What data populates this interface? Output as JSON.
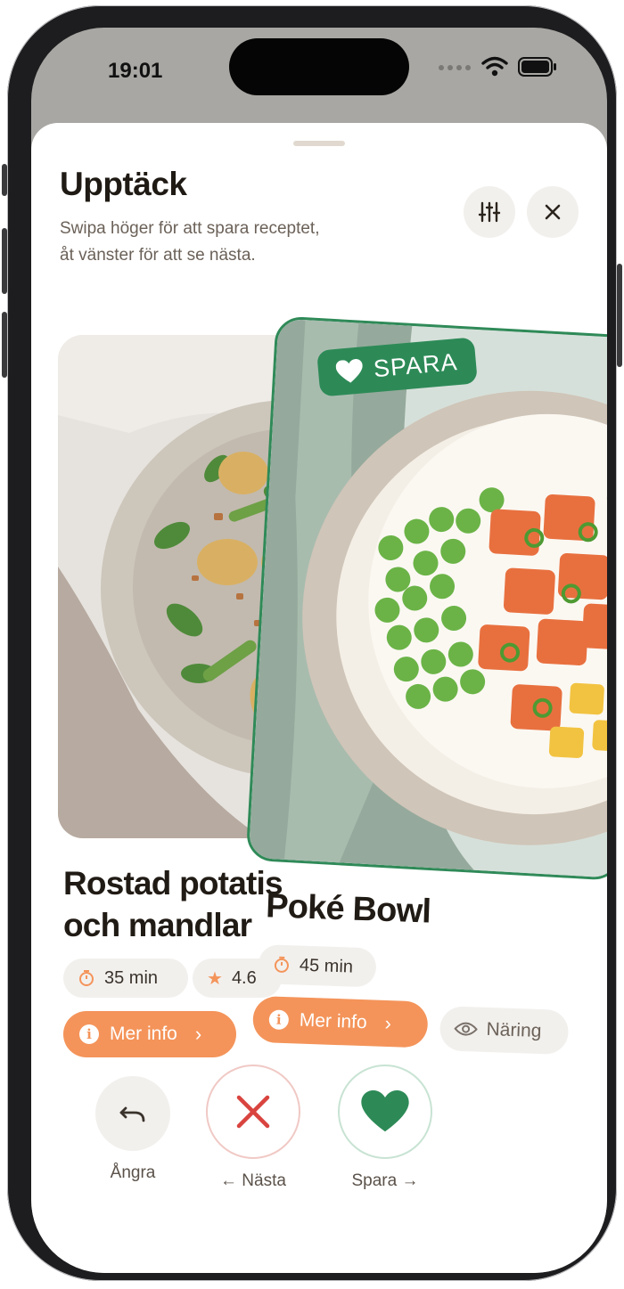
{
  "status_bar": {
    "time": "19:01"
  },
  "header": {
    "title": "Upptäck",
    "subtitle_line1": "Swipa höger för att spara receptet,",
    "subtitle_line2": "åt vänster för att se nästa.",
    "filter_icon": "sliders-icon",
    "close_icon": "close-icon"
  },
  "back_card": {
    "title_line1": "Rostad potatis",
    "title_line2": "och mandlar",
    "time": "35 min",
    "rating": "4.6",
    "more_info": "Mer info"
  },
  "front_card": {
    "badge": "SPARA",
    "title": "Poké Bowl",
    "time": "45 min",
    "more_info": "Mer info",
    "nutrition": "Näring"
  },
  "actions": {
    "undo": "Ångra",
    "next": "← Nästa",
    "save": "Spara →"
  },
  "colors": {
    "accent_orange": "#f4945a",
    "accent_green": "#2d8a57",
    "danger_red": "#d9443f"
  }
}
